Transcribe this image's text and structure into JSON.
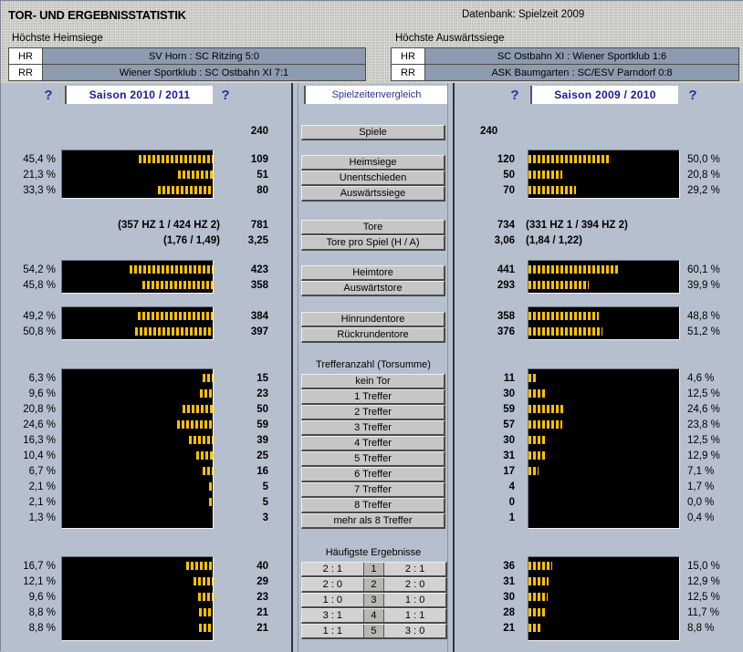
{
  "header": {
    "title": "TOR- UND ERGEBNISSTATISTIK",
    "database": "Datenbank: Spielzeit 2009",
    "home_caption": "Höchste Heimsiege",
    "away_caption": "Höchste Auswärtssiege",
    "home_rows": [
      {
        "key": "HR",
        "value": "SV Horn : SC Ritzing 5:0"
      },
      {
        "key": "RR",
        "value": "Wiener Sportklub : SC Ostbahn XI 7:1"
      }
    ],
    "away_rows": [
      {
        "key": "HR",
        "value": "SC Ostbahn XI : Wiener Sportklub 1:6"
      },
      {
        "key": "RR",
        "value": "ASK Baumgarten : SC/ESV Parndorf 0:8"
      }
    ]
  },
  "tabs": {
    "left_season": "Saison 2010 / 2011",
    "right_season": "Saison 2009 / 2010",
    "middle": "Spielzeitenvergleich",
    "help": "?"
  },
  "group_captions": {
    "trefferanzahl": "Trefferanzahl (Torsumme)",
    "ergebnisse": "Häufigste Ergebnisse"
  },
  "buttons": {
    "spiele": "Spiele",
    "heimsiege": "Heimsiege",
    "unentschieden": "Unentschieden",
    "auswaertssiege": "Auswärtssiege",
    "tore": "Tore",
    "tore_pro_spiel": "Tore pro Spiel (H / A)",
    "heimtore": "Heimtore",
    "auswaertstore": "Auswärtstore",
    "hinrundentore": "Hinrundentore",
    "rueckrundentore": "Rückrundentore",
    "kein_tor": "kein Tor",
    "t1": "1 Treffer",
    "t2": "2 Treffer",
    "t3": "3 Treffer",
    "t4": "4 Treffer",
    "t5": "5 Treffer",
    "t6": "6 Treffer",
    "t7": "7 Treffer",
    "t8": "8 Treffer",
    "t_more": "mehr als 8 Treffer"
  },
  "chart_data": {
    "type": "bar",
    "title": "TOR- UND ERGEBNISSTATISTIK",
    "orientation": "horizontal",
    "left_season": "Saison 2010 / 2011",
    "right_season": "Saison 2009 / 2010",
    "sections": [
      {
        "name": "spiele",
        "categories": [
          "Spiele"
        ],
        "left": {
          "values": [
            240
          ],
          "percents": [
            ""
          ]
        },
        "right": {
          "values": [
            240
          ],
          "percents": [
            ""
          ]
        }
      },
      {
        "name": "ergebnisverteilung",
        "categories": [
          "Heimsiege",
          "Unentschieden",
          "Auswärtssiege"
        ],
        "left": {
          "values": [
            109,
            51,
            80
          ],
          "percents": [
            "45,4 %",
            "21,3 %",
            "33,3 %"
          ]
        },
        "right": {
          "values": [
            120,
            50,
            70
          ],
          "percents": [
            "50,0 %",
            "20,8 %",
            "29,2 %"
          ]
        }
      },
      {
        "name": "tore",
        "categories": [
          "Tore",
          "Tore pro Spiel (H / A)"
        ],
        "left": {
          "values": [
            "781",
            "3,25"
          ],
          "notes": [
            "(357 HZ 1 / 424 HZ 2)",
            "(1,76 / 1,49)"
          ]
        },
        "right": {
          "values": [
            "734",
            "3,06"
          ],
          "notes": [
            "(331 HZ 1 / 394 HZ 2)",
            "(1,84 / 1,22)"
          ]
        }
      },
      {
        "name": "heim-auswaertstore",
        "categories": [
          "Heimtore",
          "Auswärtstore"
        ],
        "left": {
          "values": [
            423,
            358
          ],
          "percents": [
            "54,2 %",
            "45,8 %"
          ]
        },
        "right": {
          "values": [
            441,
            293
          ],
          "percents": [
            "60,1 %",
            "39,9 %"
          ]
        }
      },
      {
        "name": "rundentore",
        "categories": [
          "Hinrundentore",
          "Rückrundentore"
        ],
        "left": {
          "values": [
            384,
            397
          ],
          "percents": [
            "49,2 %",
            "50,8 %"
          ]
        },
        "right": {
          "values": [
            358,
            376
          ],
          "percents": [
            "48,8 %",
            "51,2 %"
          ]
        }
      },
      {
        "name": "trefferanzahl",
        "categories": [
          "kein Tor",
          "1 Treffer",
          "2 Treffer",
          "3 Treffer",
          "4 Treffer",
          "5 Treffer",
          "6 Treffer",
          "7 Treffer",
          "8 Treffer",
          "mehr als 8 Treffer"
        ],
        "left": {
          "values": [
            15,
            23,
            50,
            59,
            39,
            25,
            16,
            5,
            5,
            3
          ],
          "percents": [
            "6,3 %",
            "9,6 %",
            "20,8 %",
            "24,6 %",
            "16,3 %",
            "10,4 %",
            "6,7 %",
            "2,1 %",
            "2,1 %",
            "1,3 %"
          ]
        },
        "right": {
          "values": [
            11,
            30,
            59,
            57,
            30,
            31,
            17,
            4,
            0,
            1
          ],
          "percents": [
            "4,6 %",
            "12,5 %",
            "24,6 %",
            "23,8 %",
            "12,5 %",
            "12,9 %",
            "7,1 %",
            "1,7 %",
            "0,0 %",
            "0,4 %"
          ]
        }
      },
      {
        "name": "haeufigste-ergebnisse",
        "ranks": [
          "1",
          "2",
          "3",
          "4",
          "5"
        ],
        "left": {
          "results": [
            "2 : 1",
            "2 : 0",
            "1 : 0",
            "3 : 1",
            "1 : 1"
          ],
          "values": [
            40,
            29,
            23,
            21,
            21
          ],
          "percents": [
            "16,7 %",
            "12,1 %",
            "9,6 %",
            "8,8 %",
            "8,8 %"
          ]
        },
        "right": {
          "results": [
            "2 : 1",
            "2 : 0",
            "1 : 0",
            "1 : 1",
            "3 : 0"
          ],
          "values": [
            36,
            31,
            30,
            28,
            21
          ],
          "percents": [
            "15,0 %",
            "12,9 %",
            "12,5 %",
            "11,7 %",
            "8,8 %"
          ]
        }
      }
    ]
  },
  "colors": {
    "bar": "#ffc000",
    "panel_bg": "#b6bfcd",
    "chart_bg": "#000000",
    "tab_text": "#1a1a9e",
    "table_value_bg": "#8d9bb0"
  }
}
